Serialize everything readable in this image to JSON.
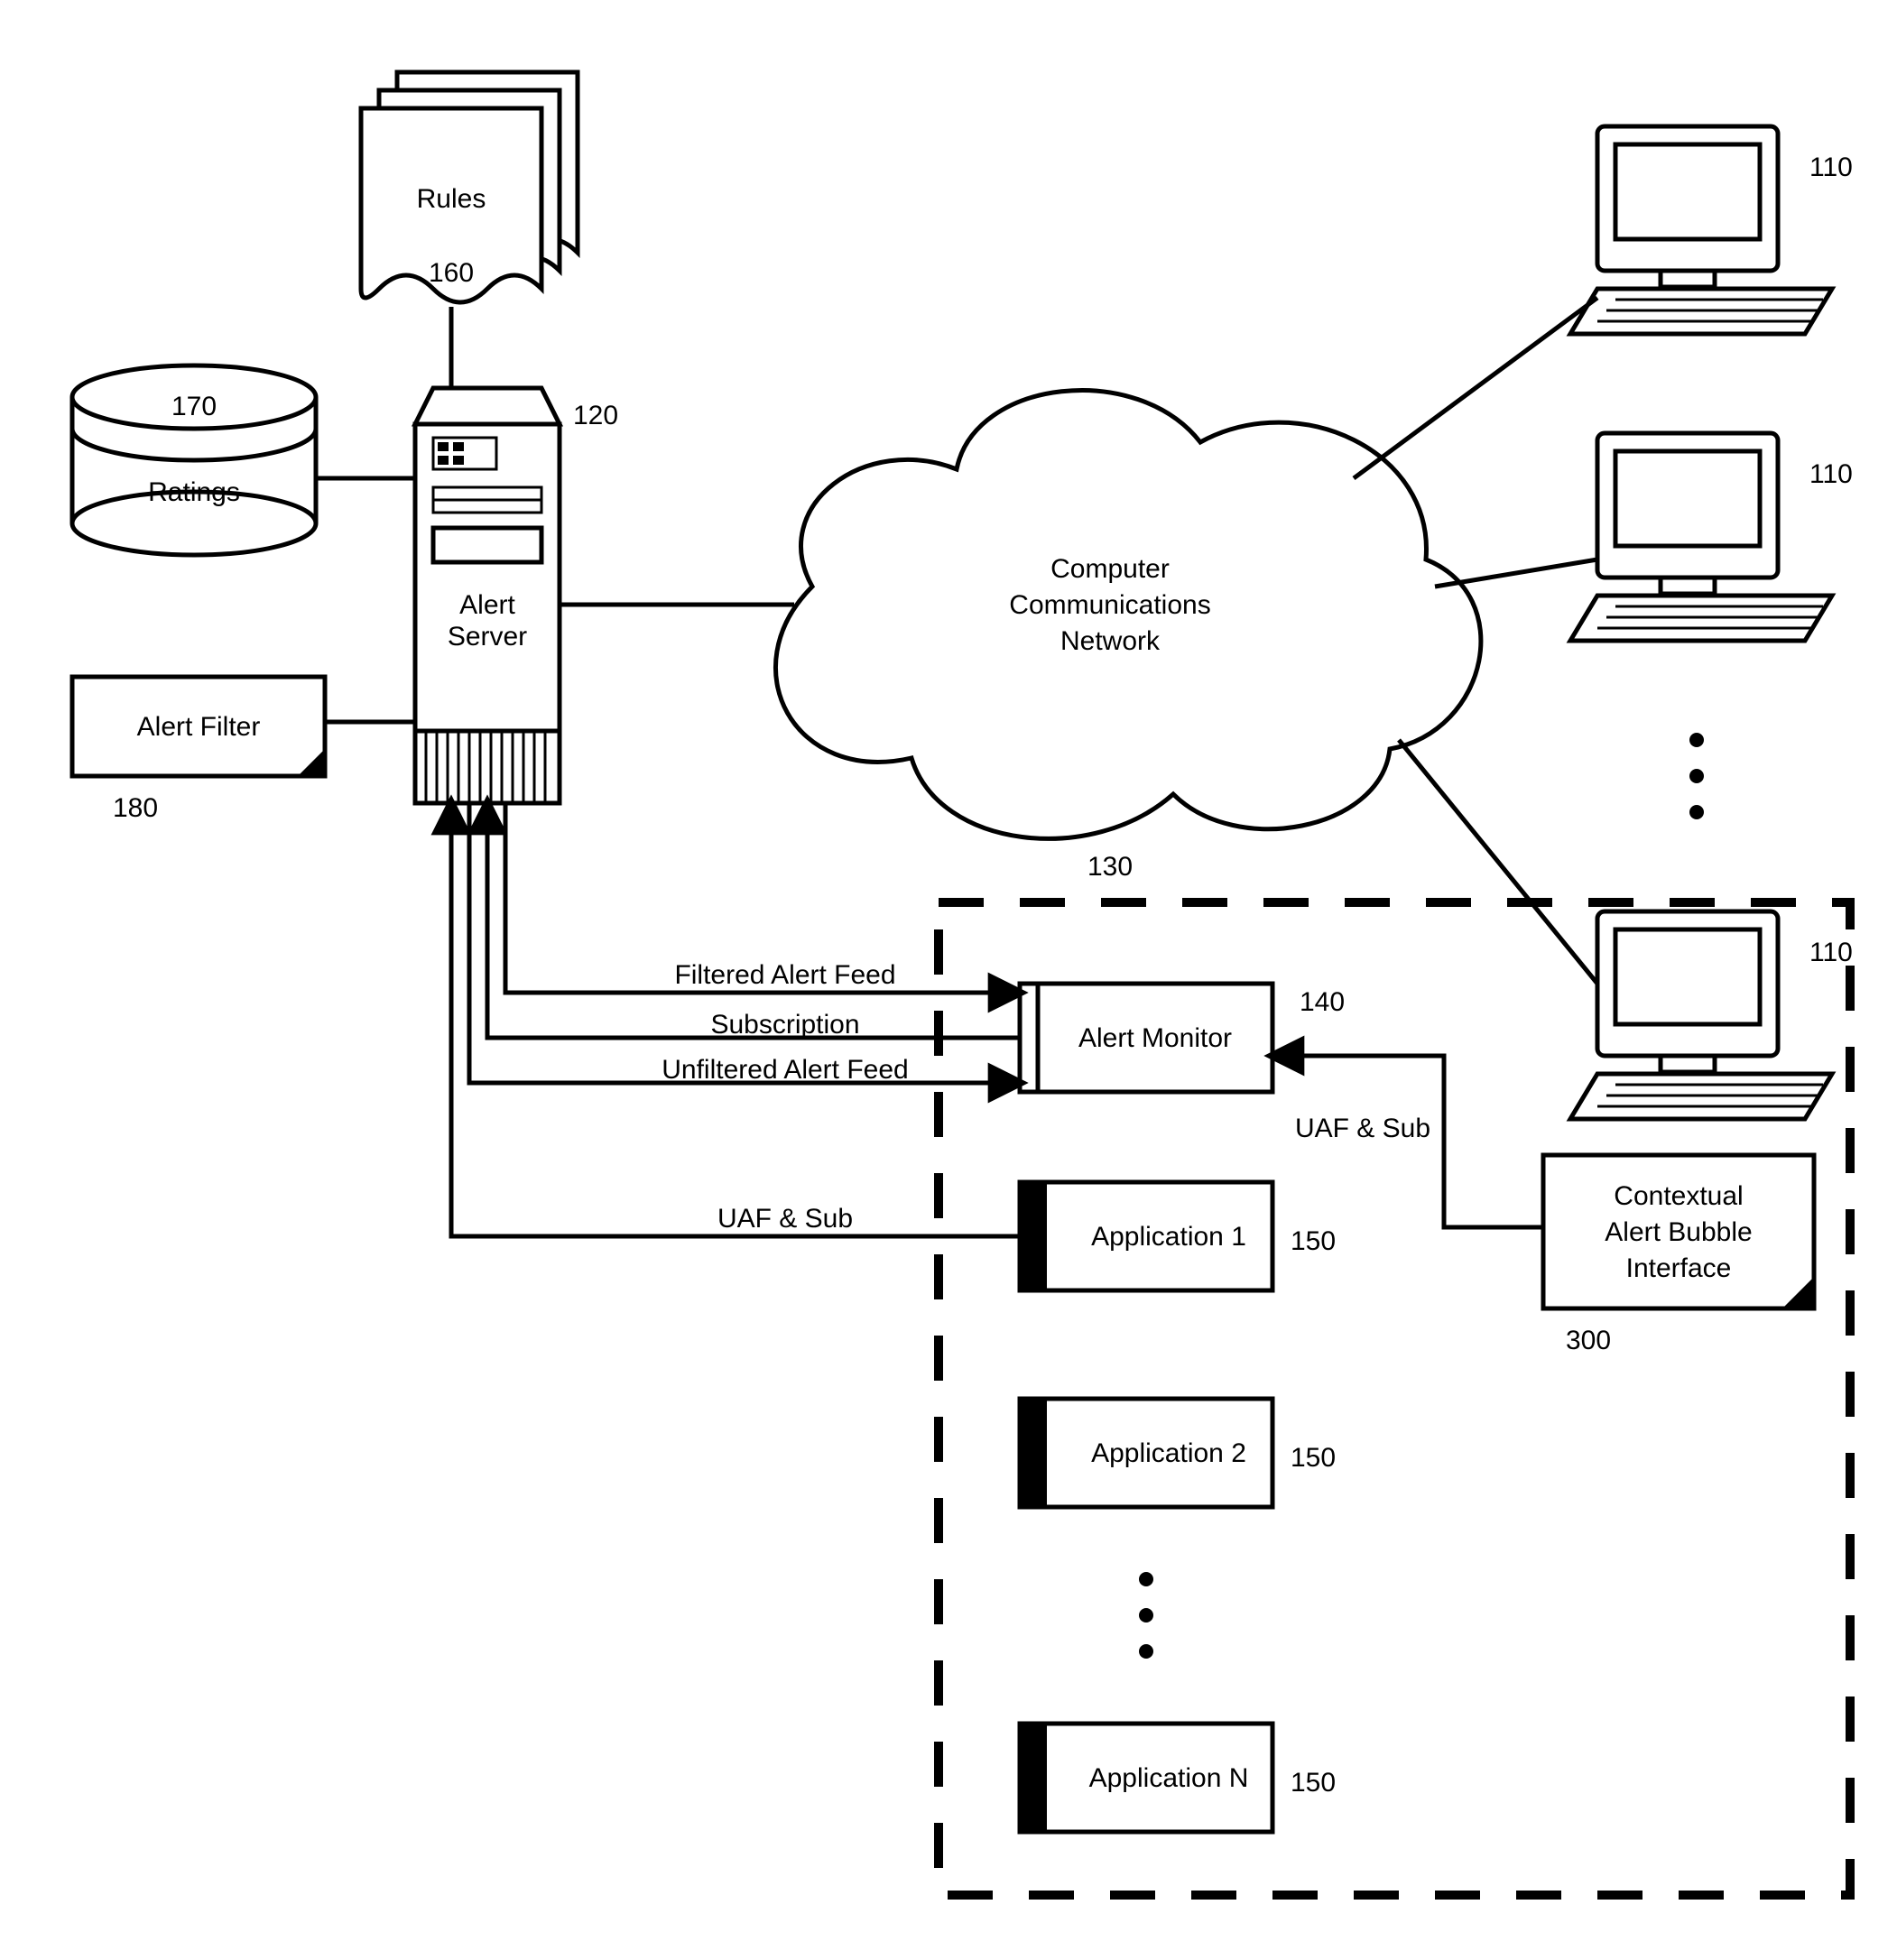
{
  "nodes": {
    "rules": {
      "label": "Rules",
      "ref": "160"
    },
    "ratings": {
      "label": "Ratings",
      "ref": "170"
    },
    "alertServer": {
      "label": "Alert\nServer",
      "ref": "120"
    },
    "alertFilter": {
      "label": "Alert Filter",
      "ref": "180"
    },
    "network": {
      "label": "Computer\nCommunications\nNetwork",
      "ref": "130"
    },
    "alertMonitor": {
      "label": "Alert Monitor",
      "ref": "140"
    },
    "app1": {
      "label": "Application 1",
      "ref": "150"
    },
    "app2": {
      "label": "Application 2",
      "ref": "150"
    },
    "appN": {
      "label": "Application N",
      "ref": "150"
    },
    "contextual": {
      "label": "Contextual\nAlert Bubble\nInterface",
      "ref": "300"
    },
    "computer": {
      "ref": "110"
    }
  },
  "edges": {
    "filteredFeed": "Filtered Alert Feed",
    "subscription": "Subscription",
    "unfilteredFeed": "Unfiltered Alert Feed",
    "uafSub": "UAF & Sub",
    "uafSubInner": "UAF & Sub"
  }
}
